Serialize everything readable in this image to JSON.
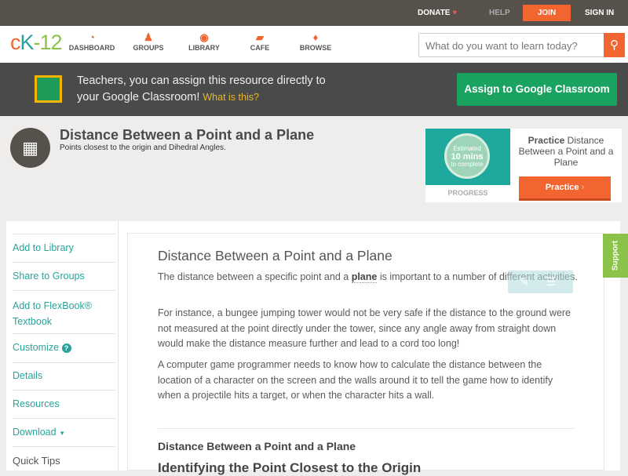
{
  "topbar": {
    "donate": "DONATE",
    "help": "HELP",
    "join": "JOIN",
    "signin": "SIGN IN"
  },
  "nav": {
    "logo": "cK-12",
    "items": [
      {
        "label": "DASHBOARD",
        "icon": "gauge-icon"
      },
      {
        "label": "GROUPS",
        "icon": "people-icon"
      },
      {
        "label": "LIBRARY",
        "icon": "backpack-icon"
      },
      {
        "label": "CAFE",
        "icon": "chat-icon"
      },
      {
        "label": "BROWSE",
        "icon": "bulb-icon"
      }
    ],
    "search_placeholder": "What do you want to learn today?"
  },
  "banner": {
    "line1": "Teachers, you can assign this resource directly to",
    "line2": "your Google Classroom!",
    "what": "What is this?",
    "button": "Assign to Google Classroom"
  },
  "header": {
    "title": "Distance Between a Point and a Plane",
    "subtitle": "Points closest to the origin and Dihedral Angles."
  },
  "practice": {
    "estimated": "Estimated",
    "mins": "10 mins",
    "complete": "to complete",
    "progress": "PROGRESS",
    "bold": "Practice",
    "rest": " Distance Between a Point and a Plane",
    "button": "Practice"
  },
  "sidebar": {
    "items": [
      "Add to Library",
      "Share to Groups",
      "Add to FlexBook®",
      "Textbook",
      "Customize",
      "Details",
      "Resources",
      "Download"
    ],
    "quick_tips": "Quick Tips"
  },
  "content": {
    "title": "Distance Between a Point and a Plane",
    "p1a": "The distance between a specific point and a ",
    "p1b": "plane",
    "p1c": " is important to a number of different activities.",
    "p2": "For instance, a bungee jumping tower would not be very safe if the distance to the ground were not measured at the point directly under the tower, since any angle away from straight down would make the distance measure further and lead to a cord too long!",
    "p3": "A computer game programmer needs to know how to calculate the distance between the location of a character on the screen and the walls around it to tell the game how to identify when a projectile hits a target, or when the character hits a wall.",
    "h3": "Distance Between a Point and a Plane",
    "h2": "Identifying the Point Closest to the Origin"
  },
  "support": "Support"
}
